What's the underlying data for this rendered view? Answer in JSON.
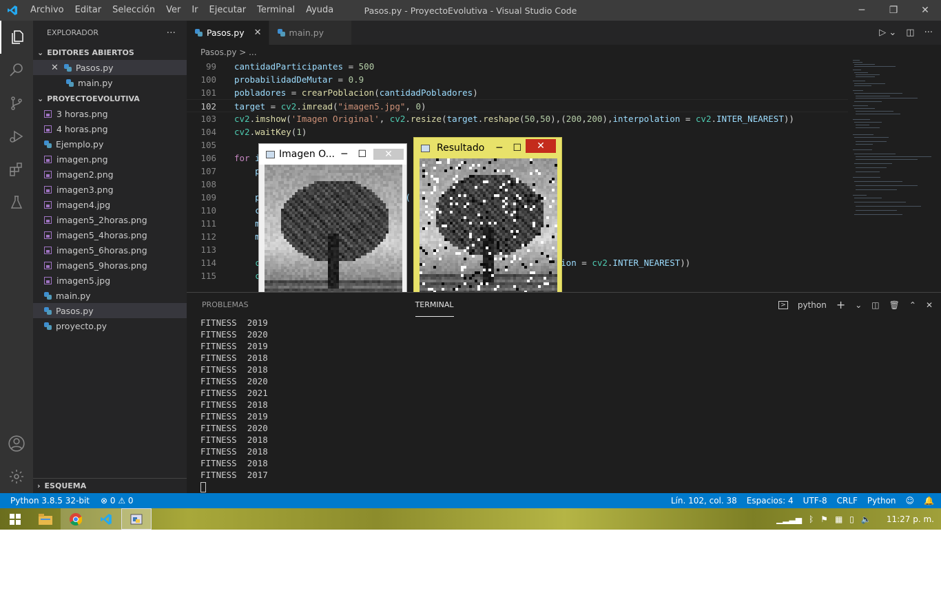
{
  "menu": {
    "items": [
      "Archivo",
      "Editar",
      "Selección",
      "Ver",
      "Ir",
      "Ejecutar",
      "Terminal",
      "Ayuda"
    ]
  },
  "window": {
    "title": "Pasos.py - ProyectoEvolutiva - Visual Studio Code"
  },
  "sidebar": {
    "header": "EXPLORADOR",
    "open_editors_title": "EDITORES ABIERTOS",
    "open_editors": [
      "Pasos.py",
      "main.py"
    ],
    "project_title": "PROYECTOEVOLUTIVA",
    "files": [
      {
        "name": "3 horas.png",
        "type": "image"
      },
      {
        "name": "4 horas.png",
        "type": "image"
      },
      {
        "name": "Ejemplo.py",
        "type": "python"
      },
      {
        "name": "imagen.png",
        "type": "image"
      },
      {
        "name": "imagen2.png",
        "type": "image"
      },
      {
        "name": "imagen3.png",
        "type": "image"
      },
      {
        "name": "imagen4.jpg",
        "type": "image"
      },
      {
        "name": "imagen5_2horas.png",
        "type": "image"
      },
      {
        "name": "imagen5_4horas.png",
        "type": "image"
      },
      {
        "name": "imagen5_6horas.png",
        "type": "image"
      },
      {
        "name": "imagen5_9horas.png",
        "type": "image"
      },
      {
        "name": "imagen5.jpg",
        "type": "image"
      },
      {
        "name": "main.py",
        "type": "python"
      },
      {
        "name": "Pasos.py",
        "type": "python"
      },
      {
        "name": "proyecto.py",
        "type": "python"
      }
    ],
    "outline_title": "ESQUEMA"
  },
  "editor": {
    "tabs": [
      "Pasos.py",
      "main.py"
    ],
    "breadcrumb": "Pasos.py > ...",
    "line_numbers": [
      "99",
      "100",
      "101",
      "102",
      "103",
      "104",
      "105",
      "106",
      "107",
      "108",
      "109",
      "110",
      "111",
      "112",
      "113",
      "114",
      "115"
    ]
  },
  "popups": {
    "original_title": "Imagen O...",
    "result_title": "Resultado"
  },
  "panel": {
    "tabs": [
      "PROBLEMAS",
      "TERMINAL"
    ],
    "shell": "python",
    "lines": [
      "FITNESS  2019",
      "FITNESS  2020",
      "FITNESS  2019",
      "FITNESS  2018",
      "FITNESS  2018",
      "FITNESS  2020",
      "FITNESS  2021",
      "FITNESS  2018",
      "FITNESS  2019",
      "FITNESS  2020",
      "FITNESS  2018",
      "FITNESS  2018",
      "FITNESS  2018",
      "FITNESS  2017"
    ]
  },
  "status": {
    "python": "Python 3.8.5 32-bit",
    "problems": "⊗ 0 ⚠ 0",
    "position": "Lín. 102, col. 38",
    "spaces": "Espacios: 4",
    "encoding": "UTF-8",
    "eol": "CRLF",
    "language": "Python"
  },
  "taskbar": {
    "time": "11:27 p. m."
  }
}
